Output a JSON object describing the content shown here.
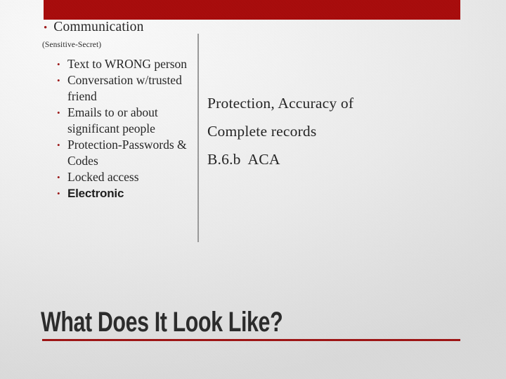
{
  "slide": {
    "title": "What Does It Look Like?",
    "accent_color": "#a80b0b",
    "bullet_color": "#9e1a1a",
    "rule_color": "#9e1414",
    "divider_color": "#9a9a9a",
    "background_color": "#ebebeb"
  },
  "left_column": {
    "level1": {
      "bullet_glyph": "•",
      "text": "Communication"
    },
    "subnote": "(Sensitive-Secret)",
    "items": [
      {
        "bullet_glyph": "•",
        "text": "Text to WRONG person",
        "style": "serif"
      },
      {
        "bullet_glyph": "•",
        "text": "Conversation w/trusted friend",
        "style": "serif"
      },
      {
        "bullet_glyph": "•",
        "text": "Emails to or about significant people",
        "style": "serif"
      },
      {
        "bullet_glyph": "•",
        "text": "Protection-Passwords & Codes",
        "style": "serif"
      },
      {
        "bullet_glyph": "•",
        "text": "Locked access",
        "style": "serif"
      },
      {
        "bullet_glyph": "•",
        "text": "Electronic",
        "style": "sans-bold"
      }
    ]
  },
  "right_column": {
    "lines": [
      "Protection, Accuracy of",
      "Complete records",
      "B.6.b  ACA"
    ]
  }
}
